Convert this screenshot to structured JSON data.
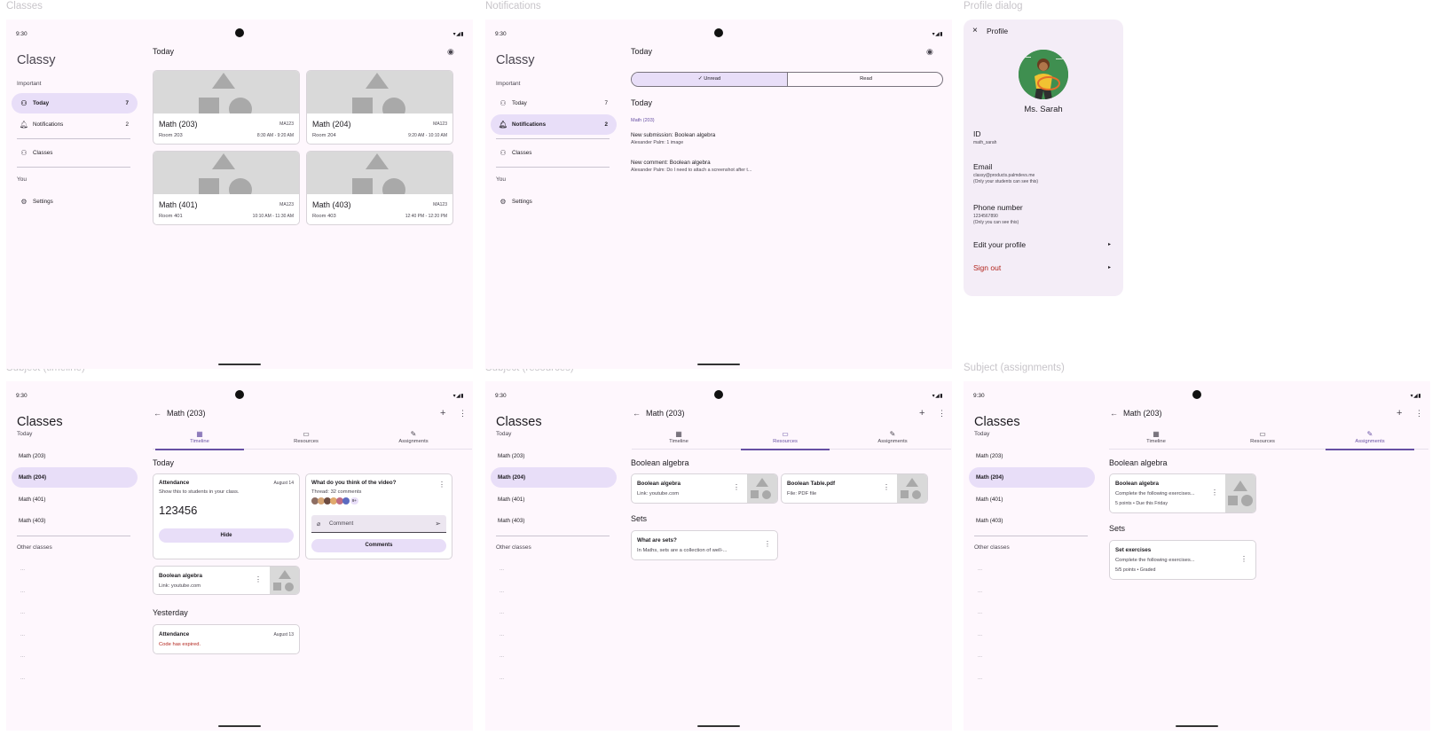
{
  "labels": {
    "classes": "Classes",
    "notifications": "Notifications",
    "profile_dialog": "Profile dialog",
    "subject_timeline": "Subject (timeline)",
    "subject_resources": "Subject (resources)",
    "subject_assignments": "Subject (assignments)"
  },
  "status": {
    "time": "9:30",
    "icons": "▾◢▮"
  },
  "nav_classy": {
    "app": "Classy",
    "important": "Important",
    "today": "Today",
    "today_count": "7",
    "notifications": "Notifications",
    "notifications_count": "2",
    "classes": "Classes",
    "you": "You",
    "settings": "Settings"
  },
  "nav_classes": {
    "app": "Classes",
    "today": "Today",
    "items": [
      "Math (203)",
      "Math (204)",
      "Math (401)",
      "Math (403)"
    ],
    "other": "Other classes",
    "dots": "..."
  },
  "today": {
    "title": "Today",
    "cards": [
      {
        "name": "Math (203)",
        "code": "MA123",
        "room": "Room 203",
        "time": "8:30 AM - 9:20 AM"
      },
      {
        "name": "Math (204)",
        "code": "MA123",
        "room": "Room 204",
        "time": "9:20 AM - 10:10 AM"
      },
      {
        "name": "Math (401)",
        "code": "MA123",
        "room": "Room 401",
        "time": "10:10 AM - 11:30 AM"
      },
      {
        "name": "Math (403)",
        "code": "MA123",
        "room": "Room 403",
        "time": "12:40 PM - 12:20 PM"
      }
    ]
  },
  "notif": {
    "title": "Today",
    "unread": "Unread",
    "read": "Read",
    "section": "Today",
    "class": "Math (203)",
    "n1_title": "New submission: Boolean algebra",
    "n1_sub": "Alexander Palm: 1 image",
    "n2_title": "New comment: Boolean algebra",
    "n2_sub": "Alexander Palm: Do I need to attach a screenshot after t..."
  },
  "profile": {
    "title": "Profile",
    "name": "Ms. Sarah",
    "id_label": "ID",
    "id_value": "math_sarah",
    "email_label": "Email",
    "email_value": "classy@products.palmdevs.me",
    "email_note": "(Only your students can see this)",
    "phone_label": "Phone number",
    "phone_value": "1234567890",
    "phone_note": "(Only you can see this)",
    "edit": "Edit your profile",
    "signout": "Sign out"
  },
  "subject": {
    "title": "Math (203)",
    "tab_timeline": "Timeline",
    "tab_resources": "Resources",
    "tab_assignments": "Assignments"
  },
  "timeline": {
    "today": "Today",
    "att_title": "Attendance",
    "att_date": "August 14",
    "att_desc": "Show this to students in your class.",
    "att_code": "123456",
    "hide": "Hide",
    "video_title": "What do you think of the video?",
    "thread": "Thread: 32 comments",
    "avatars_more": "9+",
    "comment_placeholder": "Comment",
    "comments_btn": "Comments",
    "bool_title": "Boolean algebra",
    "bool_link": "Link: youtube.com",
    "yesterday": "Yesterday",
    "att2_title": "Attendance",
    "att2_date": "August 13",
    "att2_expired": "Code has expired."
  },
  "resources": {
    "sec1": "Boolean algebra",
    "r1_title": "Boolean algebra",
    "r1_sub": "Link: youtube.com",
    "r2_title": "Boolean Table.pdf",
    "r2_sub": "File: PDF file",
    "sec2": "Sets",
    "r3_title": "What are sets?",
    "r3_sub": "In Maths, sets are a collection of well-..."
  },
  "assignments": {
    "sec1": "Boolean algebra",
    "a1_title": "Boolean algebra",
    "a1_sub": "Complete the following exercises...",
    "a1_meta": "5 points • Due this Friday",
    "sec2": "Sets",
    "a2_title": "Set exercises",
    "a2_sub": "Complete the following exercises...",
    "a2_meta": "5/5 points • Graded"
  },
  "colors": {
    "bg": "#fef7fd",
    "accent": "#6750a4",
    "selected": "#e8def8",
    "danger": "#b3261e"
  }
}
